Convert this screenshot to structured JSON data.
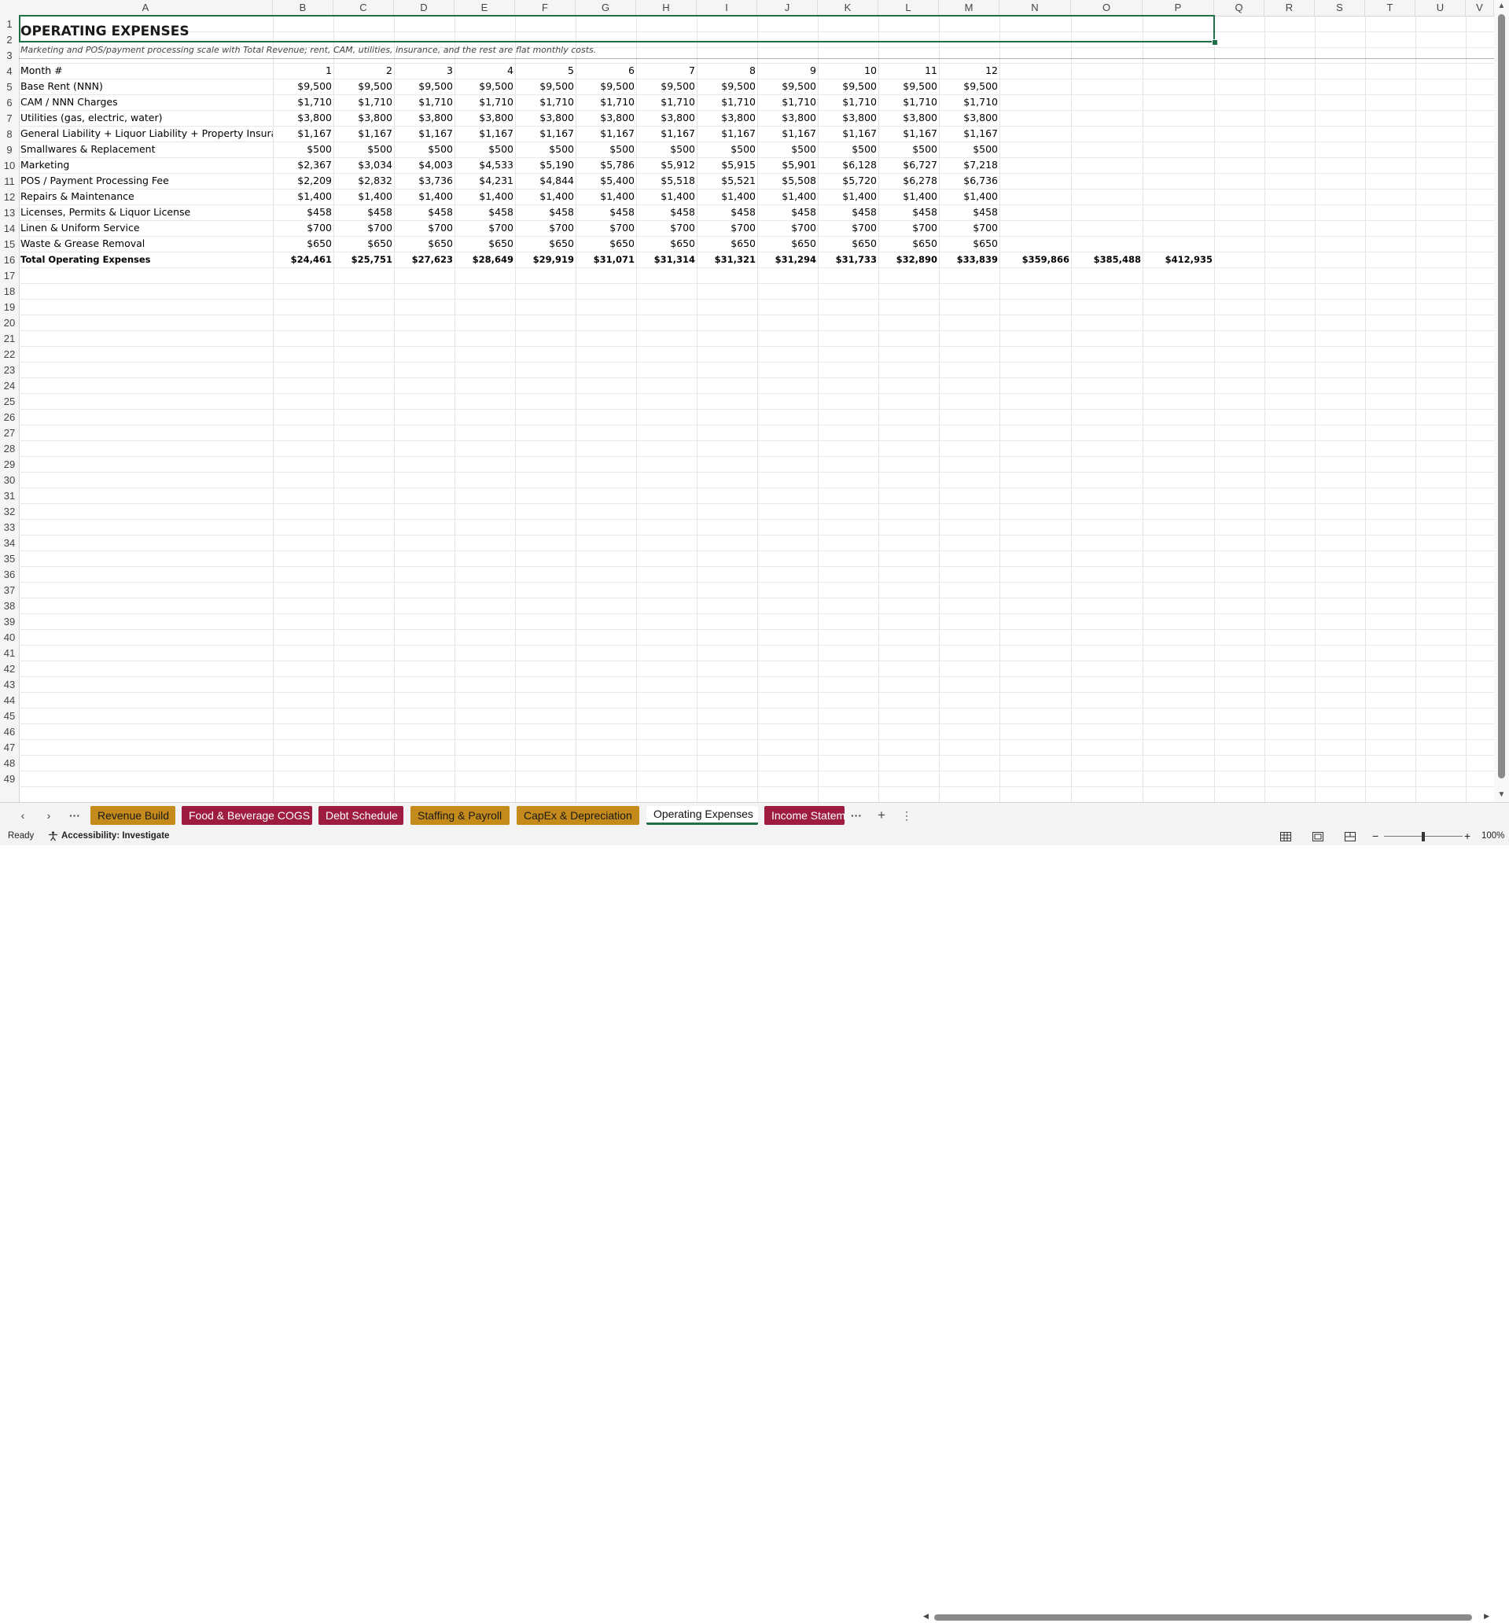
{
  "columns": [
    "A",
    "B",
    "C",
    "D",
    "E",
    "F",
    "G",
    "H",
    "I",
    "J",
    "K",
    "L",
    "M",
    "N",
    "O",
    "P",
    "Q",
    "R",
    "S",
    "T",
    "U",
    "V"
  ],
  "rows": [
    "1",
    "2",
    "3",
    "4",
    "5",
    "6",
    "7",
    "8",
    "9",
    "10",
    "11",
    "12",
    "13",
    "14",
    "15",
    "16",
    "17",
    "18",
    "19",
    "20",
    "21",
    "22",
    "23",
    "24",
    "25",
    "26",
    "27",
    "28",
    "29",
    "30",
    "31",
    "32",
    "33",
    "34",
    "35",
    "36",
    "37",
    "38",
    "39",
    "40",
    "41",
    "42",
    "43",
    "44",
    "45",
    "46",
    "47",
    "48",
    "49"
  ],
  "sheet": {
    "title": "OPERATING EXPENSES",
    "note": "Marketing and POS/payment processing scale with Total Revenue; rent, CAM, utilities, insurance, and the rest are flat monthly costs.",
    "month_label": "Month #",
    "months": [
      "1",
      "2",
      "3",
      "4",
      "5",
      "6",
      "7",
      "8",
      "9",
      "10",
      "11",
      "12"
    ],
    "items": [
      {
        "label": "Base Rent (NNN)",
        "values": [
          "$9,500",
          "$9,500",
          "$9,500",
          "$9,500",
          "$9,500",
          "$9,500",
          "$9,500",
          "$9,500",
          "$9,500",
          "$9,500",
          "$9,500",
          "$9,500"
        ]
      },
      {
        "label": "CAM / NNN Charges",
        "values": [
          "$1,710",
          "$1,710",
          "$1,710",
          "$1,710",
          "$1,710",
          "$1,710",
          "$1,710",
          "$1,710",
          "$1,710",
          "$1,710",
          "$1,710",
          "$1,710"
        ]
      },
      {
        "label": "Utilities (gas, electric, water)",
        "values": [
          "$3,800",
          "$3,800",
          "$3,800",
          "$3,800",
          "$3,800",
          "$3,800",
          "$3,800",
          "$3,800",
          "$3,800",
          "$3,800",
          "$3,800",
          "$3,800"
        ]
      },
      {
        "label": "General Liability + Liquor Liability + Property Insuran",
        "values": [
          "$1,167",
          "$1,167",
          "$1,167",
          "$1,167",
          "$1,167",
          "$1,167",
          "$1,167",
          "$1,167",
          "$1,167",
          "$1,167",
          "$1,167",
          "$1,167"
        ]
      },
      {
        "label": "Smallwares & Replacement",
        "values": [
          "$500",
          "$500",
          "$500",
          "$500",
          "$500",
          "$500",
          "$500",
          "$500",
          "$500",
          "$500",
          "$500",
          "$500"
        ]
      },
      {
        "label": "Marketing",
        "values": [
          "$2,367",
          "$3,034",
          "$4,003",
          "$4,533",
          "$5,190",
          "$5,786",
          "$5,912",
          "$5,915",
          "$5,901",
          "$6,128",
          "$6,727",
          "$7,218"
        ]
      },
      {
        "label": "POS / Payment Processing Fee",
        "values": [
          "$2,209",
          "$2,832",
          "$3,736",
          "$4,231",
          "$4,844",
          "$5,400",
          "$5,518",
          "$5,521",
          "$5,508",
          "$5,720",
          "$6,278",
          "$6,736"
        ]
      },
      {
        "label": "Repairs & Maintenance",
        "values": [
          "$1,400",
          "$1,400",
          "$1,400",
          "$1,400",
          "$1,400",
          "$1,400",
          "$1,400",
          "$1,400",
          "$1,400",
          "$1,400",
          "$1,400",
          "$1,400"
        ]
      },
      {
        "label": "Licenses, Permits & Liquor License",
        "values": [
          "$458",
          "$458",
          "$458",
          "$458",
          "$458",
          "$458",
          "$458",
          "$458",
          "$458",
          "$458",
          "$458",
          "$458"
        ]
      },
      {
        "label": "Linen & Uniform Service",
        "values": [
          "$700",
          "$700",
          "$700",
          "$700",
          "$700",
          "$700",
          "$700",
          "$700",
          "$700",
          "$700",
          "$700",
          "$700"
        ]
      },
      {
        "label": "Waste & Grease Removal",
        "values": [
          "$650",
          "$650",
          "$650",
          "$650",
          "$650",
          "$650",
          "$650",
          "$650",
          "$650",
          "$650",
          "$650",
          "$650"
        ]
      }
    ],
    "total": {
      "label": "Total Operating Expenses",
      "values": [
        "$24,461",
        "$25,751",
        "$27,623",
        "$28,649",
        "$29,919",
        "$31,071",
        "$31,314",
        "$31,321",
        "$31,294",
        "$31,733",
        "$32,890",
        "$33,839"
      ],
      "extra": [
        "$359,866",
        "$385,488",
        "$412,935"
      ]
    }
  },
  "tabs": {
    "sheets": [
      {
        "label": "Revenue Build",
        "color": "gold"
      },
      {
        "label": "Food & Beverage COGS",
        "color": "red"
      },
      {
        "label": "Debt Schedule",
        "color": "red"
      },
      {
        "label": "Staffing & Payroll",
        "color": "gold"
      },
      {
        "label": "CapEx & Depreciation",
        "color": "gold"
      },
      {
        "label": "Operating Expenses",
        "color": "active"
      },
      {
        "label": "Income Statem",
        "color": "red"
      }
    ],
    "prev_icon": "chevron-left-icon",
    "next_icon": "chevron-right-icon",
    "more_label": "···",
    "add_label": "+",
    "options_label": "⋮"
  },
  "status": {
    "ready": "Ready",
    "accessibility": "Accessibility: Investigate",
    "zoom": "100%",
    "zoom_minus": "−",
    "zoom_plus": "+"
  }
}
